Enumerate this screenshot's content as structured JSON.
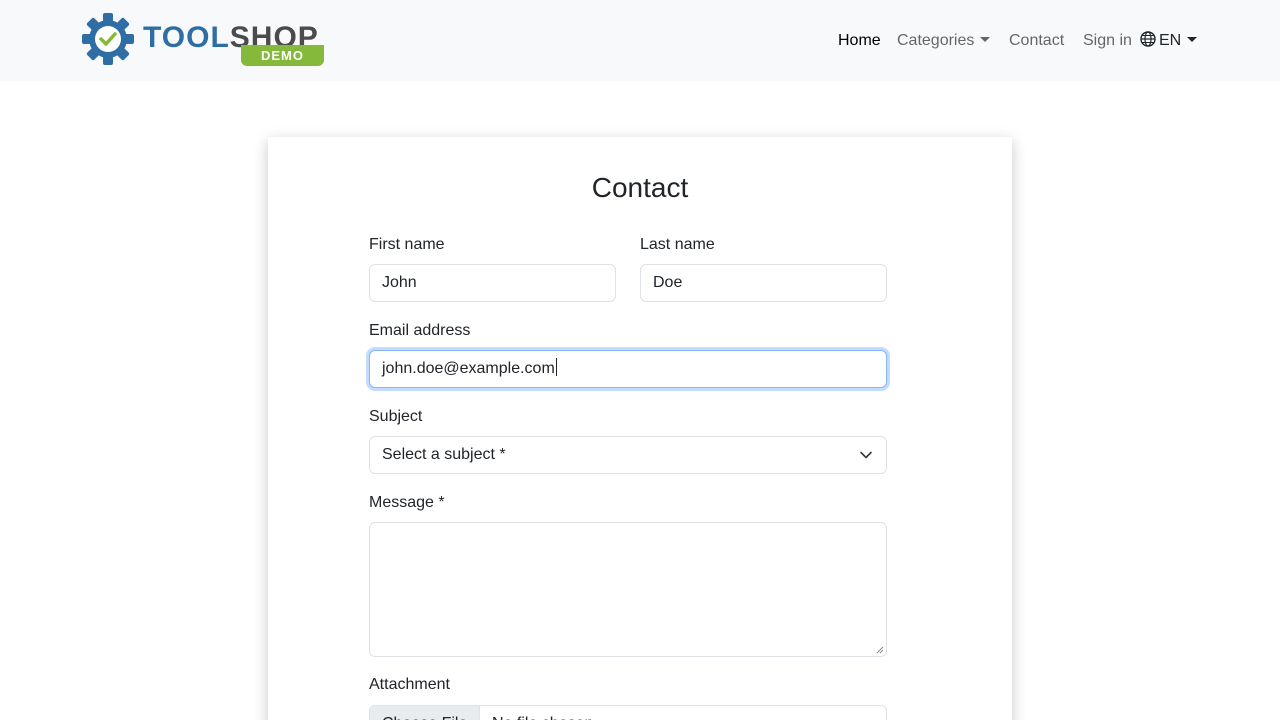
{
  "brand": {
    "word1": "TOOL",
    "word2": "SHOP",
    "badge": "DEMO"
  },
  "nav": {
    "home": "Home",
    "categories": "Categories",
    "contact": "Contact",
    "sign_in": "Sign in",
    "language": "EN"
  },
  "form": {
    "title": "Contact",
    "first_name": {
      "label": "First name",
      "value": "John"
    },
    "last_name": {
      "label": "Last name",
      "value": "Doe"
    },
    "email": {
      "label": "Email address",
      "value": "john.doe@example.com"
    },
    "subject": {
      "label": "Subject",
      "selected": "Select a subject *"
    },
    "message": {
      "label": "Message *",
      "value": ""
    },
    "attachment": {
      "label": "Attachment",
      "button": "Choose File",
      "file_name": "No file chosen"
    }
  },
  "colors": {
    "navbar_bg": "#f8f9fa",
    "brand_blue": "#2f6ea5",
    "brand_gray": "#4b4b4d",
    "badge_green": "#84b93b",
    "focus_border": "#86b7fe"
  },
  "icons": {
    "logo": "gear-check-icon",
    "language": "globe-icon",
    "dropdown": "chevron-down-icon"
  }
}
